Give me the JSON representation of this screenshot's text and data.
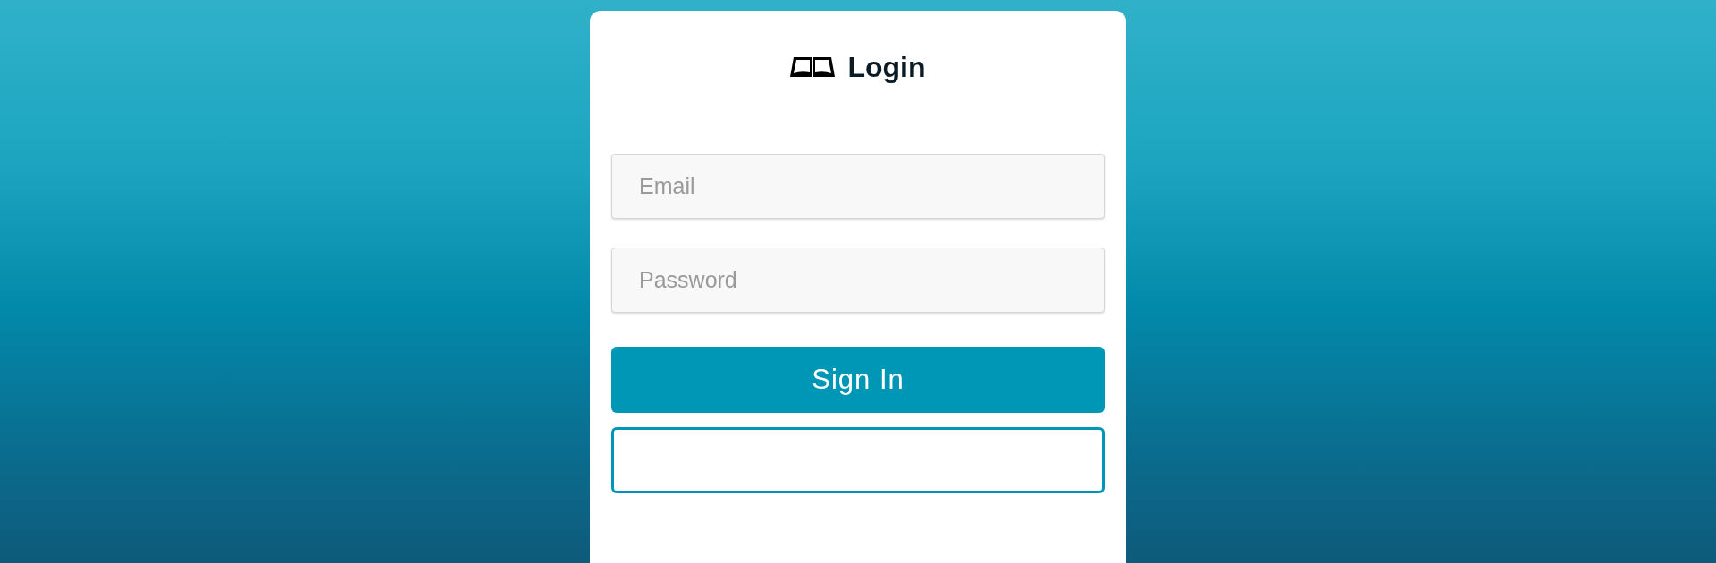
{
  "title": "Login",
  "fields": [
    {
      "placeholder": "Email"
    },
    {
      "placeholder": "Password"
    }
  ],
  "submit_button": "Sign In"
}
